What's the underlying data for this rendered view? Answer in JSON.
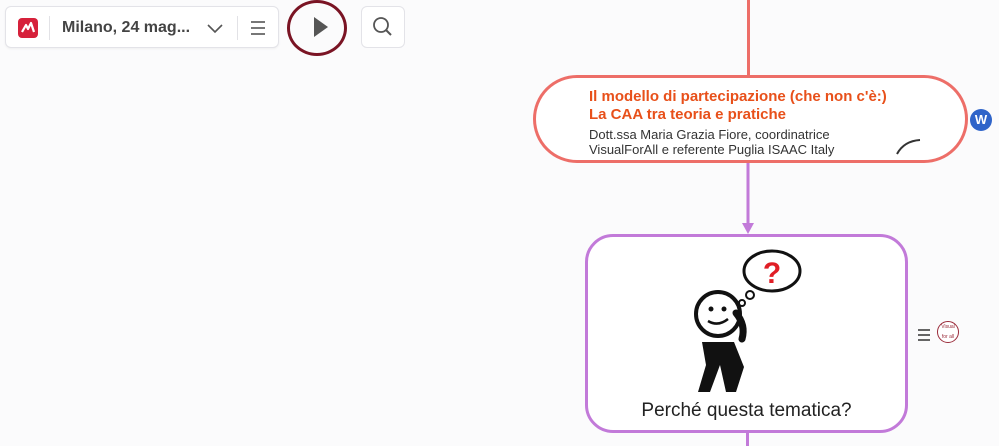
{
  "toolbar": {
    "app_logo": "mindmeister-logo",
    "map_title": "Milano, 24 mag...",
    "title_dropdown_icon": "chevron-down-icon",
    "menu_icon": "hamburger-menu-icon",
    "play_icon": "play-icon",
    "search_icon": "search-icon"
  },
  "node_topic": {
    "title_line1": "Il modello di partecipazione (che non c'è:)",
    "title_line2": "La CAA tra teoria e pratiche",
    "subtitle_line1": "Dott.ssa Maria Grazia Fiore, coordinatrice",
    "subtitle_line2": "VisualForAll e referente Puglia ISAAC Italy",
    "side_icon": "wordpress-icon",
    "side_icon_glyph": "W"
  },
  "node_question": {
    "caption": "Perché questa tematica?",
    "image": "thinking-person-question-mark",
    "question_glyph": "?",
    "notes_icon": "notes-icon",
    "badge_icon": "visual-for-all-badge-icon",
    "badge_text": "Visual for all"
  },
  "colors": {
    "brand": "#d6213b",
    "topic_border": "#ed6e68",
    "topic_title": "#e8501a",
    "question_border": "#c27ad9",
    "highlight_ring": "#7a1424"
  }
}
